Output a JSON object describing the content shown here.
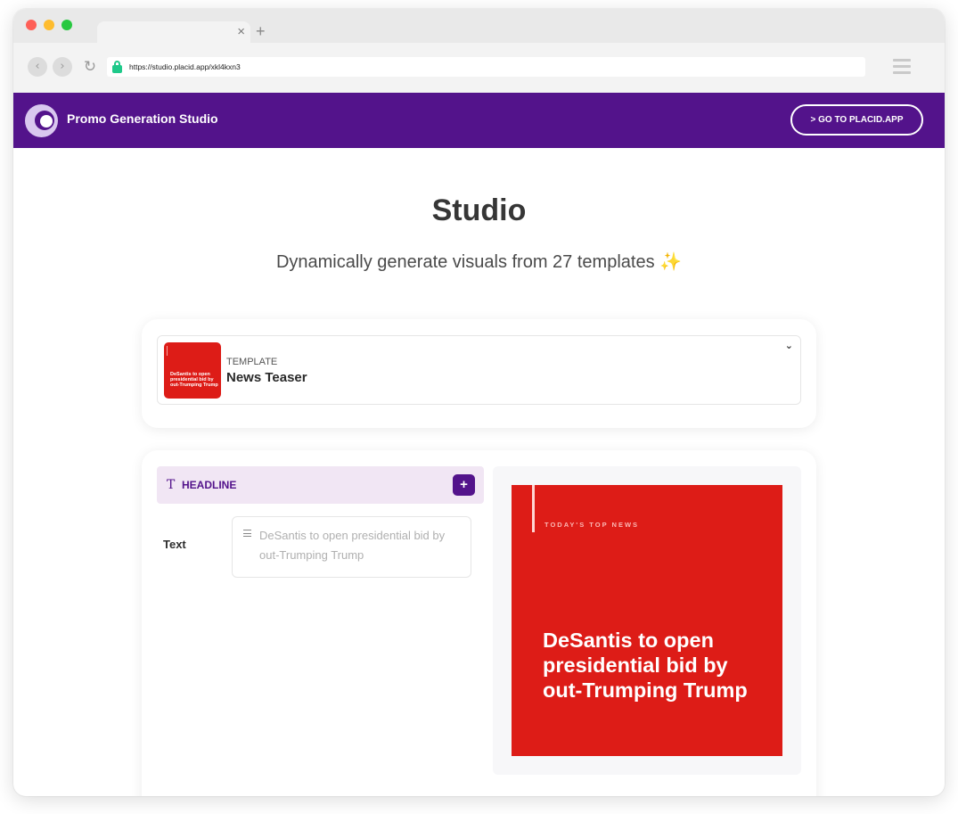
{
  "browser": {
    "url": "https://studio.placid.app/xkl4kxn3",
    "tab_close": "×",
    "new_tab": "+"
  },
  "header": {
    "brand": "Promo Generation Studio",
    "goto_button": "> GO TO PLACID.APP"
  },
  "main": {
    "title": "Studio",
    "subtitle": "Dynamically generate visuals from 27 templates",
    "subtitle_emoji": "✨"
  },
  "template_picker": {
    "label": "TEMPLATE",
    "name": "News Teaser",
    "thumbnail_text": "DeSantis to open presidential bid by out-Trumping Trump"
  },
  "layer": {
    "icon": "T",
    "title": "HEADLINE",
    "add_label": "+",
    "field_label": "Text",
    "field_value": "DeSantis to open presidential bid by out-Trumping Trump"
  },
  "preview": {
    "kicker": "TODAY'S TOP NEWS",
    "headline": "DeSantis to open presidential bid by out-Trumping Trump"
  },
  "colors": {
    "brand_purple": "#53138b",
    "accent_red": "#dd1c17",
    "layer_header_bg": "#f1e6f4"
  }
}
